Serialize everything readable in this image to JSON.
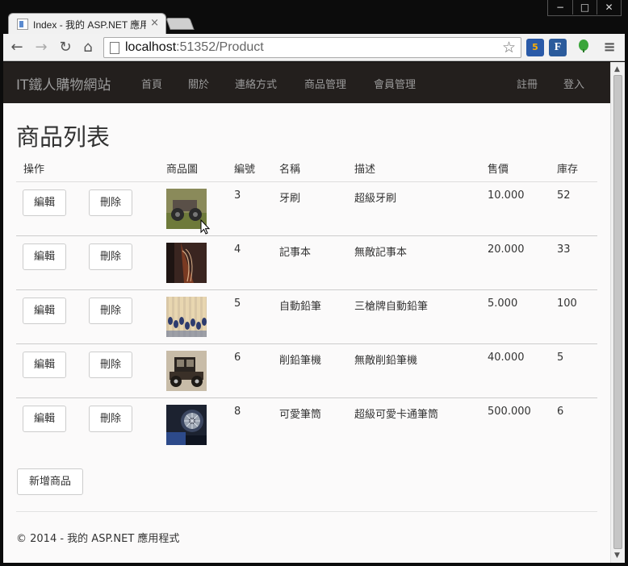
{
  "browser": {
    "tab_title": "Index - 我的 ASP.NET 應用",
    "tab_close": "×",
    "url_host": "localhost",
    "url_rest": ":51352/Product",
    "win_min": "−",
    "win_max": "□",
    "win_close": "✕",
    "ext_html5": "5",
    "ext_f": "F"
  },
  "site": {
    "brand": "IT鐵人購物網站",
    "nav": [
      "首頁",
      "關於",
      "連絡方式",
      "商品管理",
      "會員管理"
    ],
    "register": "註冊",
    "login": "登入"
  },
  "page": {
    "title": "商品列表",
    "columns": {
      "action": "操作",
      "image": "商品圖",
      "id": "編號",
      "name": "名稱",
      "desc": "描述",
      "price": "售價",
      "stock": "庫存"
    },
    "edit_label": "編輯",
    "delete_label": "刪除",
    "rows": [
      {
        "id": "3",
        "name": "牙刷",
        "desc": "超級牙刷",
        "price": "10.000",
        "stock": "52",
        "image": "vintage-car-photo"
      },
      {
        "id": "4",
        "name": "記事本",
        "desc": "無敵記事本",
        "price": "20.000",
        "stock": "33",
        "image": "violin-photo"
      },
      {
        "id": "5",
        "name": "自動鉛筆",
        "desc": "三槍牌自動鉛筆",
        "price": "5.000",
        "stock": "100",
        "image": "matches-photo"
      },
      {
        "id": "6",
        "name": "削鉛筆機",
        "desc": "無敵削鉛筆機",
        "price": "40.000",
        "stock": "5",
        "image": "old-car-photo"
      },
      {
        "id": "8",
        "name": "可愛筆筒",
        "desc": "超級可愛卡通筆筒",
        "price": "500.000",
        "stock": "6",
        "image": "motorcycle-photo"
      }
    ],
    "add_label": "新增商品",
    "footer": "© 2014 - 我的 ASP.NET 應用程式"
  }
}
